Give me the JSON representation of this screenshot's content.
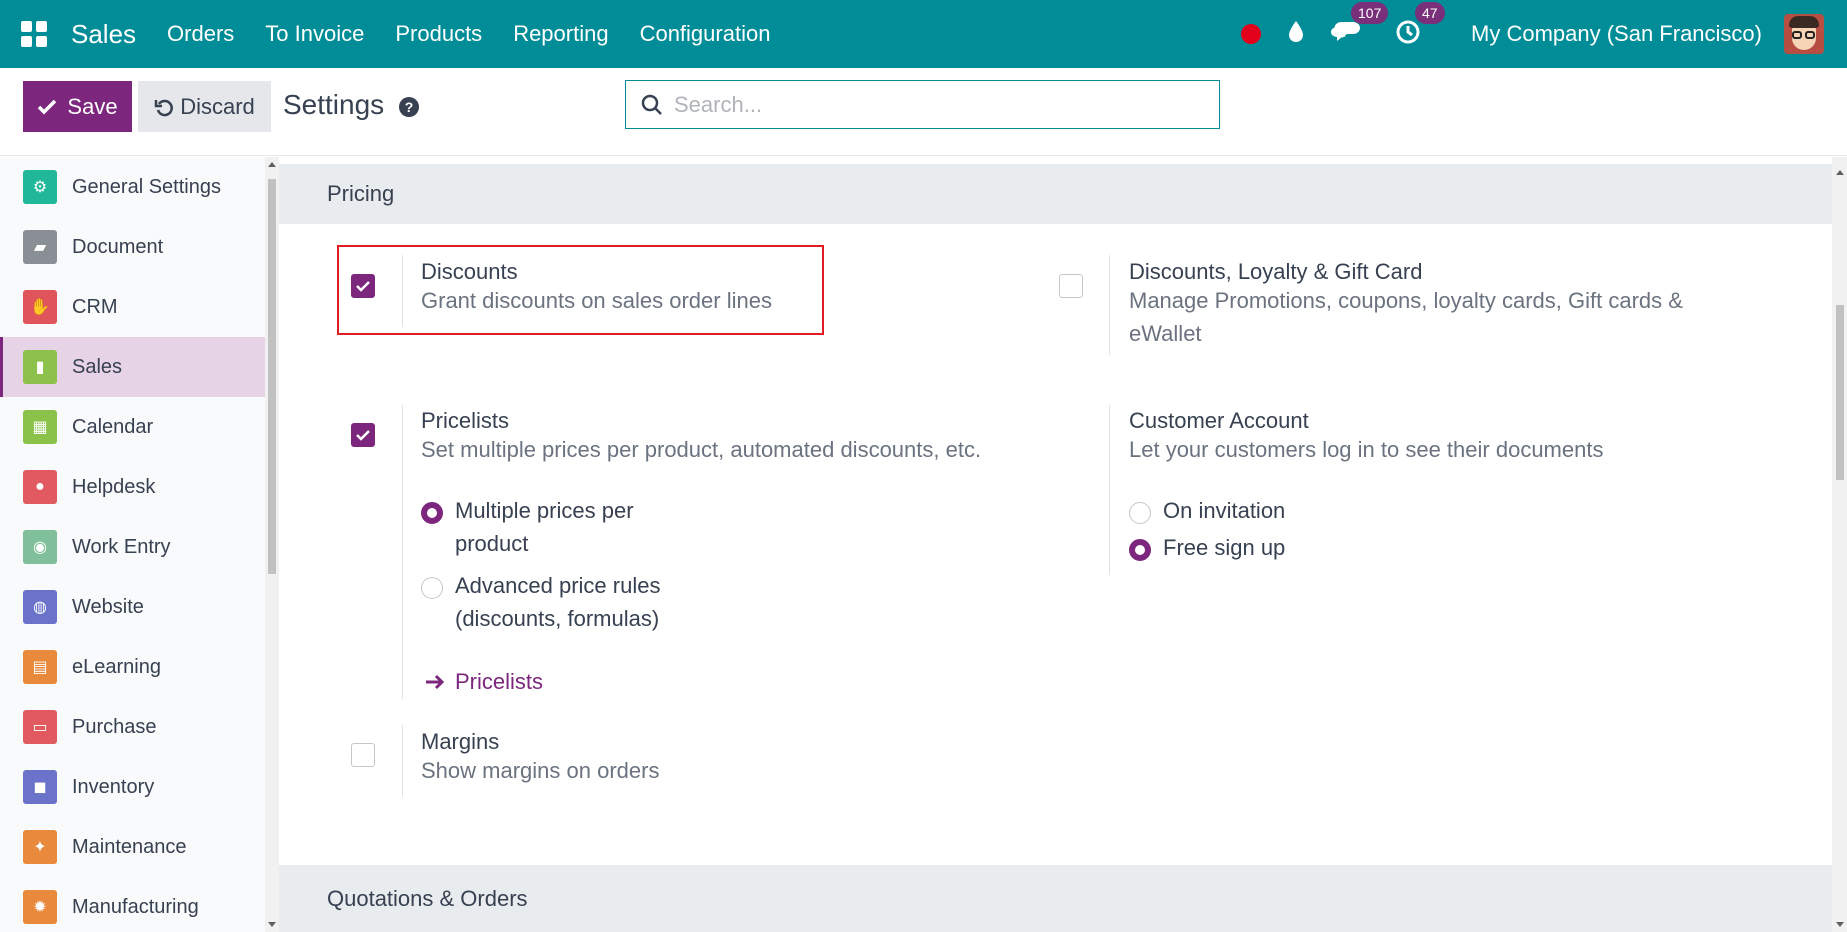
{
  "navbar": {
    "brand": "Sales",
    "menu": [
      "Orders",
      "To Invoice",
      "Products",
      "Reporting",
      "Configuration"
    ],
    "messages_badge": "107",
    "activities_badge": "47",
    "company": "My Company (San Francisco)"
  },
  "control_panel": {
    "save_label": "Save",
    "discard_label": "Discard",
    "title": "Settings",
    "search_placeholder": "Search..."
  },
  "sidebar": {
    "items": [
      {
        "label": "General Settings",
        "icon": "gear-icon",
        "color": "#21b799"
      },
      {
        "label": "Document",
        "icon": "folder-icon",
        "color": "#8a8f96"
      },
      {
        "label": "CRM",
        "icon": "handshake-icon",
        "color": "#e0545b"
      },
      {
        "label": "Sales",
        "icon": "chart-icon",
        "color": "#8cc14b"
      },
      {
        "label": "Calendar",
        "icon": "calendar-icon",
        "color": "#8bc34a"
      },
      {
        "label": "Helpdesk",
        "icon": "support-icon",
        "color": "#e05a60"
      },
      {
        "label": "Work Entry",
        "icon": "person-icon",
        "color": "#7fbf99"
      },
      {
        "label": "Website",
        "icon": "globe-icon",
        "color": "#6a73c9"
      },
      {
        "label": "eLearning",
        "icon": "certificate-icon",
        "color": "#e8893c"
      },
      {
        "label": "Purchase",
        "icon": "card-icon",
        "color": "#e05a60"
      },
      {
        "label": "Inventory",
        "icon": "box-icon",
        "color": "#6a73c9"
      },
      {
        "label": "Maintenance",
        "icon": "wrench-icon",
        "color": "#e8893c"
      },
      {
        "label": "Manufacturing",
        "icon": "cog-icon",
        "color": "#e8893c"
      }
    ],
    "active_index": 3
  },
  "main": {
    "pricing": {
      "header": "Pricing",
      "discounts": {
        "title": "Discounts",
        "desc": "Grant discounts on sales order lines",
        "checked": true
      },
      "loyalty": {
        "title": "Discounts, Loyalty & Gift Card",
        "desc_line1": "Manage Promotions, coupons, loyalty cards, Gift cards &",
        "desc_line2": "eWallet",
        "checked": false
      },
      "pricelists": {
        "title": "Pricelists",
        "desc": "Set multiple prices per product, automated discounts, etc.",
        "checked": true,
        "option1_line1": "Multiple prices per",
        "option1_line2": "product",
        "option2_line1": "Advanced price rules",
        "option2_line2": "(discounts, formulas)",
        "selected_option": 1,
        "link": "Pricelists"
      },
      "customer_account": {
        "title": "Customer Account",
        "desc": "Let your customers log in to see their documents",
        "option1": "On invitation",
        "option2": "Free sign up",
        "selected_option": 2
      },
      "margins": {
        "title": "Margins",
        "desc": "Show margins on orders",
        "checked": false
      }
    },
    "quotations_header": "Quotations & Orders"
  },
  "colors": {
    "navbar": "#018d98",
    "primary": "#7c277d",
    "highlight": "#e31b23"
  }
}
